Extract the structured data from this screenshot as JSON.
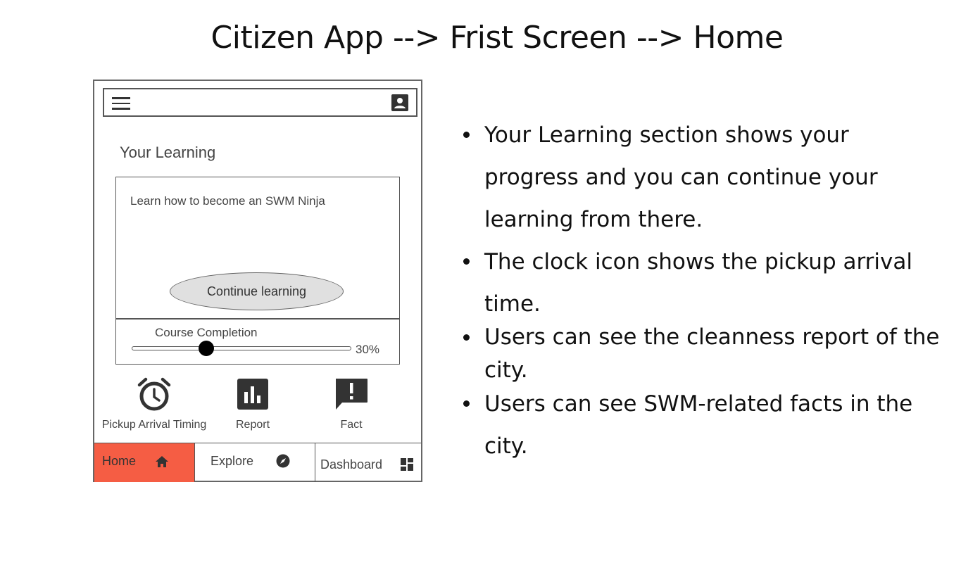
{
  "page_title": "Citizen App --> Frist Screen --> Home",
  "app": {
    "header": {
      "menu_icon": "hamburger-menu-icon",
      "profile_icon": "account-box-icon"
    },
    "learning": {
      "section_title": "Your Learning",
      "course_title": "Learn how to become an SWM Ninja",
      "continue_label": "Continue learning",
      "completion_label": "Course Completion",
      "completion_value": "30%",
      "completion_fraction": 0.3
    },
    "shortcuts": [
      {
        "label": "Pickup Arrival Timing",
        "icon": "alarm-clock-icon"
      },
      {
        "label": "Report",
        "icon": "bar-chart-icon"
      },
      {
        "label": "Fact",
        "icon": "exclamation-chat-icon"
      }
    ],
    "bottom_nav": [
      {
        "label": "Home",
        "icon": "home-icon",
        "active": true
      },
      {
        "label": "Explore",
        "icon": "compass-icon",
        "active": false
      },
      {
        "label": "Dashboard",
        "icon": "dashboard-icon",
        "active": false
      }
    ],
    "colors": {
      "active_tab": "#f55d44",
      "button_fill": "#e0e0e0"
    }
  },
  "notes": [
    "Your Learning section shows your progress and you can continue your learning from there.",
    "The clock icon shows the pickup arrival time.",
    "Users can see the cleanness report of the city.",
    "Users can see SWM-related facts in the city."
  ]
}
